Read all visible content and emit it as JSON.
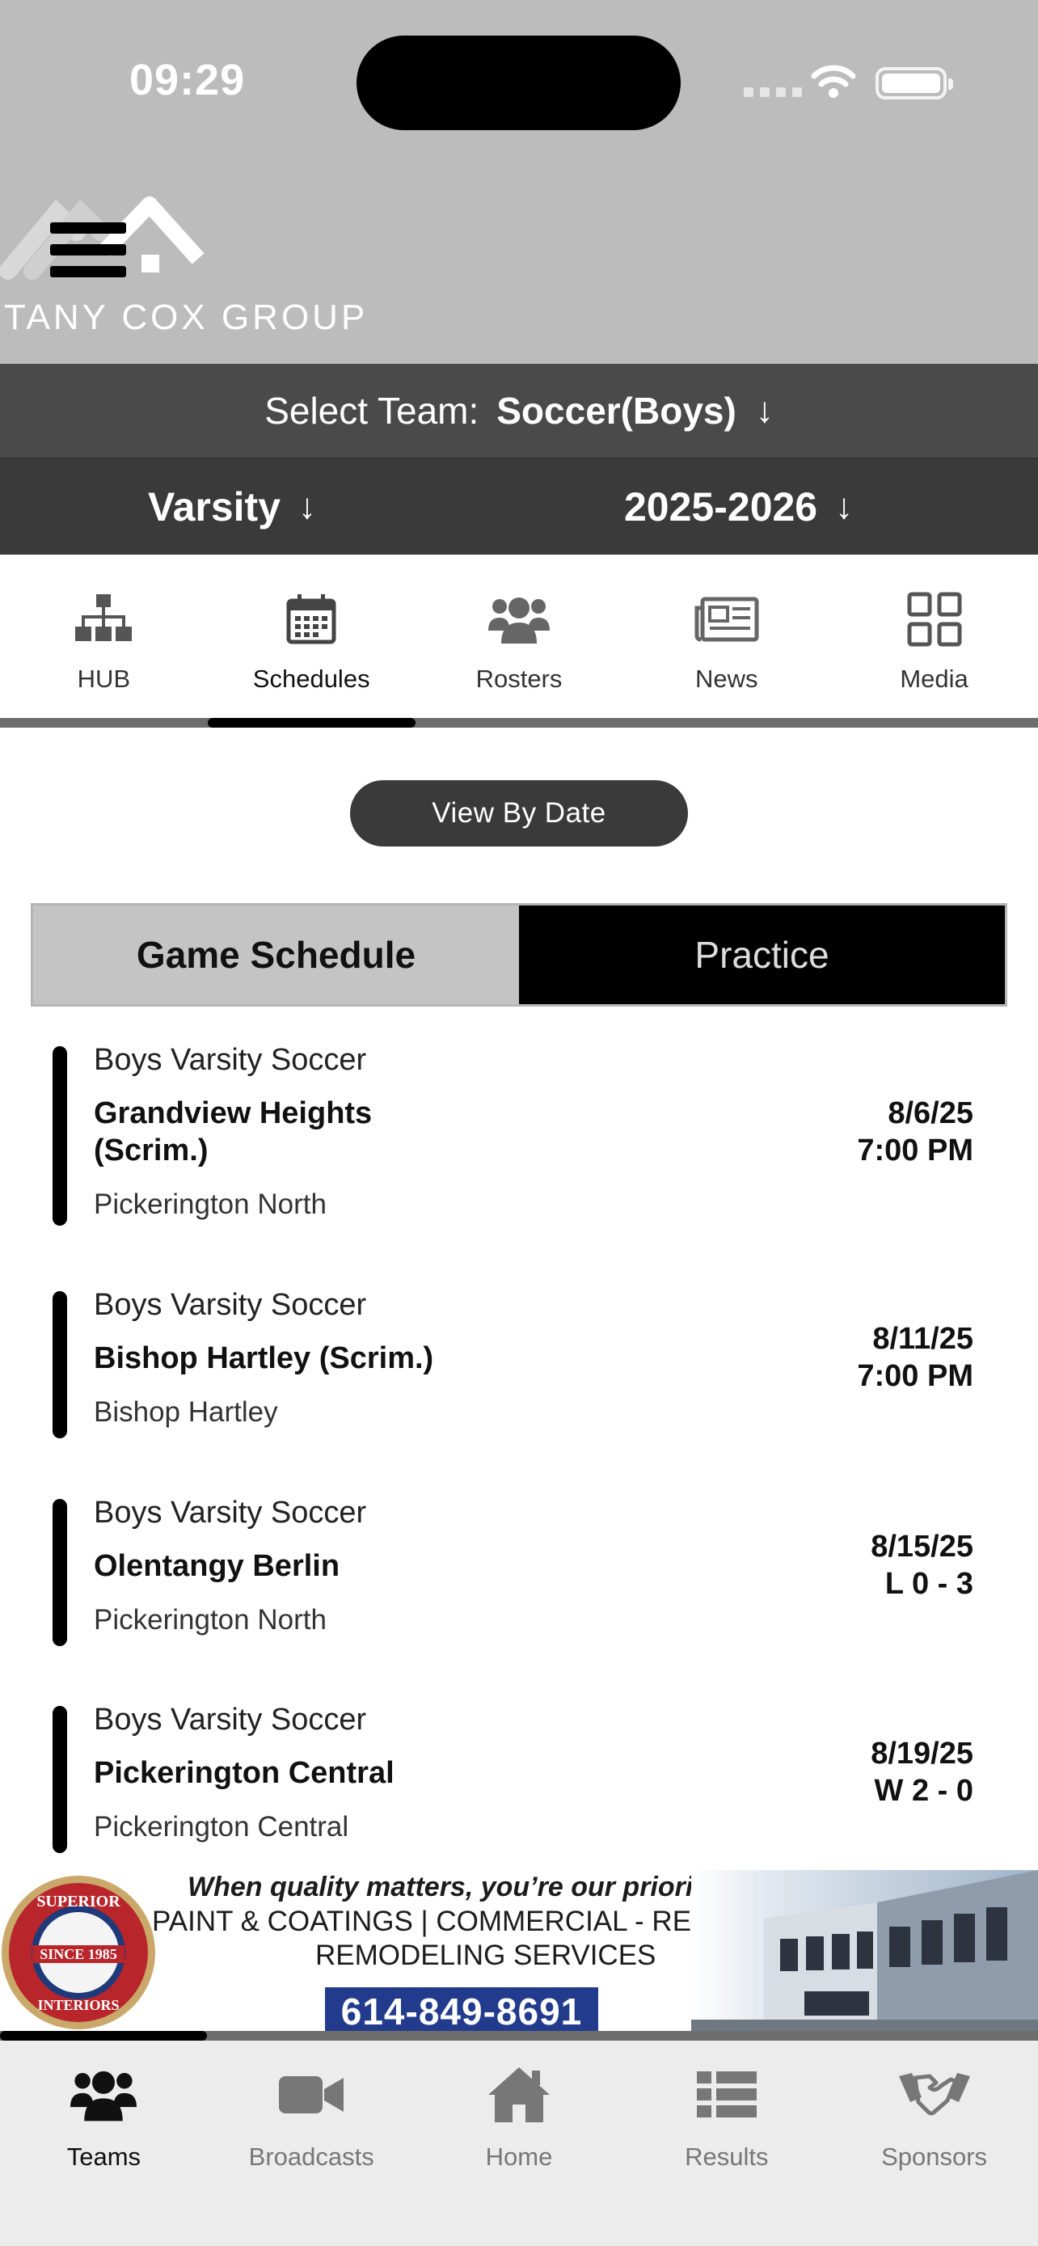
{
  "status_bar": {
    "time": "09:29"
  },
  "brand": {
    "logo_text": "TTANY COX GROUP"
  },
  "team_selector": {
    "label": "Select Team:",
    "value": "Soccer(Boys)",
    "arrow": "↓"
  },
  "level_selector": {
    "value": "Varsity",
    "arrow": "↓"
  },
  "season_selector": {
    "value": "2025-2026",
    "arrow": "↓"
  },
  "top_nav": {
    "active": "Schedules",
    "items": [
      {
        "label": "HUB",
        "icon": "org-chart-icon"
      },
      {
        "label": "Schedules",
        "icon": "calendar-icon"
      },
      {
        "label": "Rosters",
        "icon": "users-icon"
      },
      {
        "label": "News",
        "icon": "newspaper-icon"
      },
      {
        "label": "Media",
        "icon": "grid-icon"
      }
    ]
  },
  "view_button": {
    "label": "View By Date"
  },
  "segment": {
    "game": "Game Schedule",
    "practice": "Practice",
    "active": "Game Schedule"
  },
  "events": [
    {
      "category": "Boys Varsity Soccer",
      "opponent": "Grandview Heights (Scrim.)",
      "location": "Pickerington North",
      "date": "8/6/25",
      "result": "7:00 PM"
    },
    {
      "category": "Boys Varsity Soccer",
      "opponent": "Bishop Hartley (Scrim.)",
      "location": "Bishop Hartley",
      "date": "8/11/25",
      "result": "7:00 PM"
    },
    {
      "category": "Boys Varsity Soccer",
      "opponent": "Olentangy Berlin",
      "location": "Pickerington North",
      "date": "8/15/25",
      "result": "L 0 - 3"
    },
    {
      "category": "Boys Varsity Soccer",
      "opponent": "Pickerington Central",
      "location": "Pickerington Central",
      "date": "8/19/25",
      "result": "W 2 - 0"
    }
  ],
  "ad": {
    "seal_top": "SUPERIOR",
    "seal_mid": "SINCE 1985",
    "seal_bottom": "INTERIORS",
    "line1": "When quality matters, you’re our priority!",
    "line2": "PAINT & COATINGS | COMMERCIAL - RESIDENTIAL",
    "line3": "REMODELING SERVICES",
    "phone": "614-849-8691",
    "progress": 0.2
  },
  "tab_bar": {
    "active": "Teams",
    "items": [
      {
        "label": "Teams",
        "icon": "team-icon"
      },
      {
        "label": "Broadcasts",
        "icon": "video-camera-icon"
      },
      {
        "label": "Home",
        "icon": "home-icon"
      },
      {
        "label": "Results",
        "icon": "list-icon"
      },
      {
        "label": "Sponsors",
        "icon": "handshake-icon"
      }
    ]
  },
  "colors": {
    "header_bg": "#bcbcbc",
    "team_bar": "#4a4a4a",
    "level_bar": "#3a3a3a",
    "accent": "#000000",
    "phone_bg": "#223b8c"
  }
}
